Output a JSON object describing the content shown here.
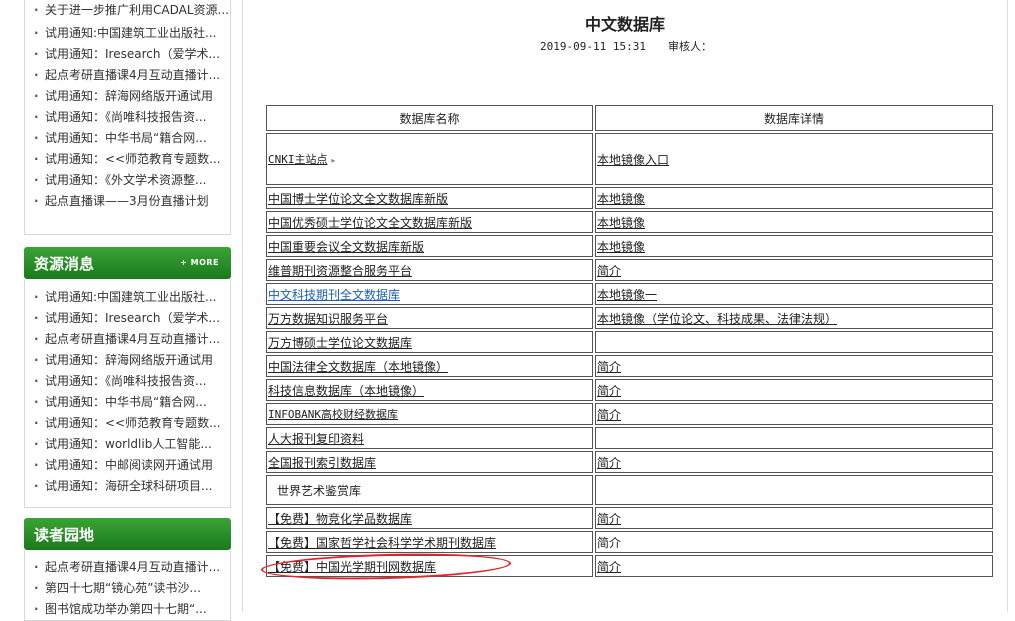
{
  "sidebar": {
    "top_list": [
      "关于进一步推广利用CADAL资源...",
      "试用通知:中国建筑工业出版社...",
      "试用通知：Iresearch（爱学术...",
      "起点考研直播课4月互动直播计...",
      "试用通知：辞海网络版开通试用",
      "试用通知：《尚唯科技报告资...",
      "试用通知：中华书局“籍合网...",
      "试用通知：<<师范教育专题数...",
      "试用通知：《外文学术资源整...",
      "起点直播课——3月份直播计划"
    ],
    "resource_title": "资源消息",
    "resource_more": "+ MORE",
    "resource_list": [
      "试用通知:中国建筑工业出版社...",
      "试用通知：Iresearch（爱学术...",
      "起点考研直播课4月互动直播计...",
      "试用通知：辞海网络版开通试用",
      "试用通知：《尚唯科技报告资...",
      "试用通知：中华书局“籍合网...",
      "试用通知：<<师范教育专题数...",
      "试用通知：worldlib人工智能...",
      "试用通知：中邮阅读网开通试用",
      "试用通知：海研全球科研项目..."
    ],
    "reader_title": "读者园地",
    "reader_list": [
      "起点考研直播课4月互动直播计...",
      "第四十七期“镜心苑”读书沙...",
      "图书馆成功举办第四十七期“..."
    ]
  },
  "main": {
    "title": "中文数据库",
    "date": "2019-09-11 15:31",
    "reviewer_label": "审核人：",
    "headers": [
      "数据库名称",
      "数据库详情"
    ],
    "rows": [
      {
        "name": "CNKI主站点",
        "detail": "本地镜像入口"
      },
      {
        "name": "中国博士学位论文全文数据库新版",
        "detail": "本地镜像"
      },
      {
        "name": "中国优秀硕士学位论文全文数据库新版",
        "detail": "本地镜像"
      },
      {
        "name": "中国重要会议全文数据库新版",
        "detail": "本地镜像"
      },
      {
        "name": "维普期刊资源整合服务平台",
        "detail": "简介"
      },
      {
        "name": "中文科技期刊全文数据库",
        "detail": "本地镜像一"
      },
      {
        "name": "万方数据知识服务平台",
        "detail": "本地镜像（学位论文、科技成果、法律法规）"
      },
      {
        "name": "万方博硕士学位论文数据库",
        "detail": ""
      },
      {
        "name": "中国法律全文数据库（本地镜像）",
        "detail": "简介"
      },
      {
        "name": "科技信息数据库（本地镜像）",
        "detail": "简介"
      },
      {
        "name": "INFOBANK高校财经数据库",
        "detail": "简介"
      },
      {
        "name": "人大报刊复印资料",
        "detail": ""
      },
      {
        "name": "全国报刊索引数据库",
        "detail": "简介"
      },
      {
        "name": "世界艺术鉴赏库",
        "detail": ""
      },
      {
        "name": "【免费】物竞化学品数据库",
        "detail": "简介"
      },
      {
        "name": "【免费】国家哲学社会科学学术期刊数据库",
        "detail": "简介"
      },
      {
        "name": "【免费】中国光学期刊网数据库",
        "detail": "简介"
      }
    ]
  }
}
